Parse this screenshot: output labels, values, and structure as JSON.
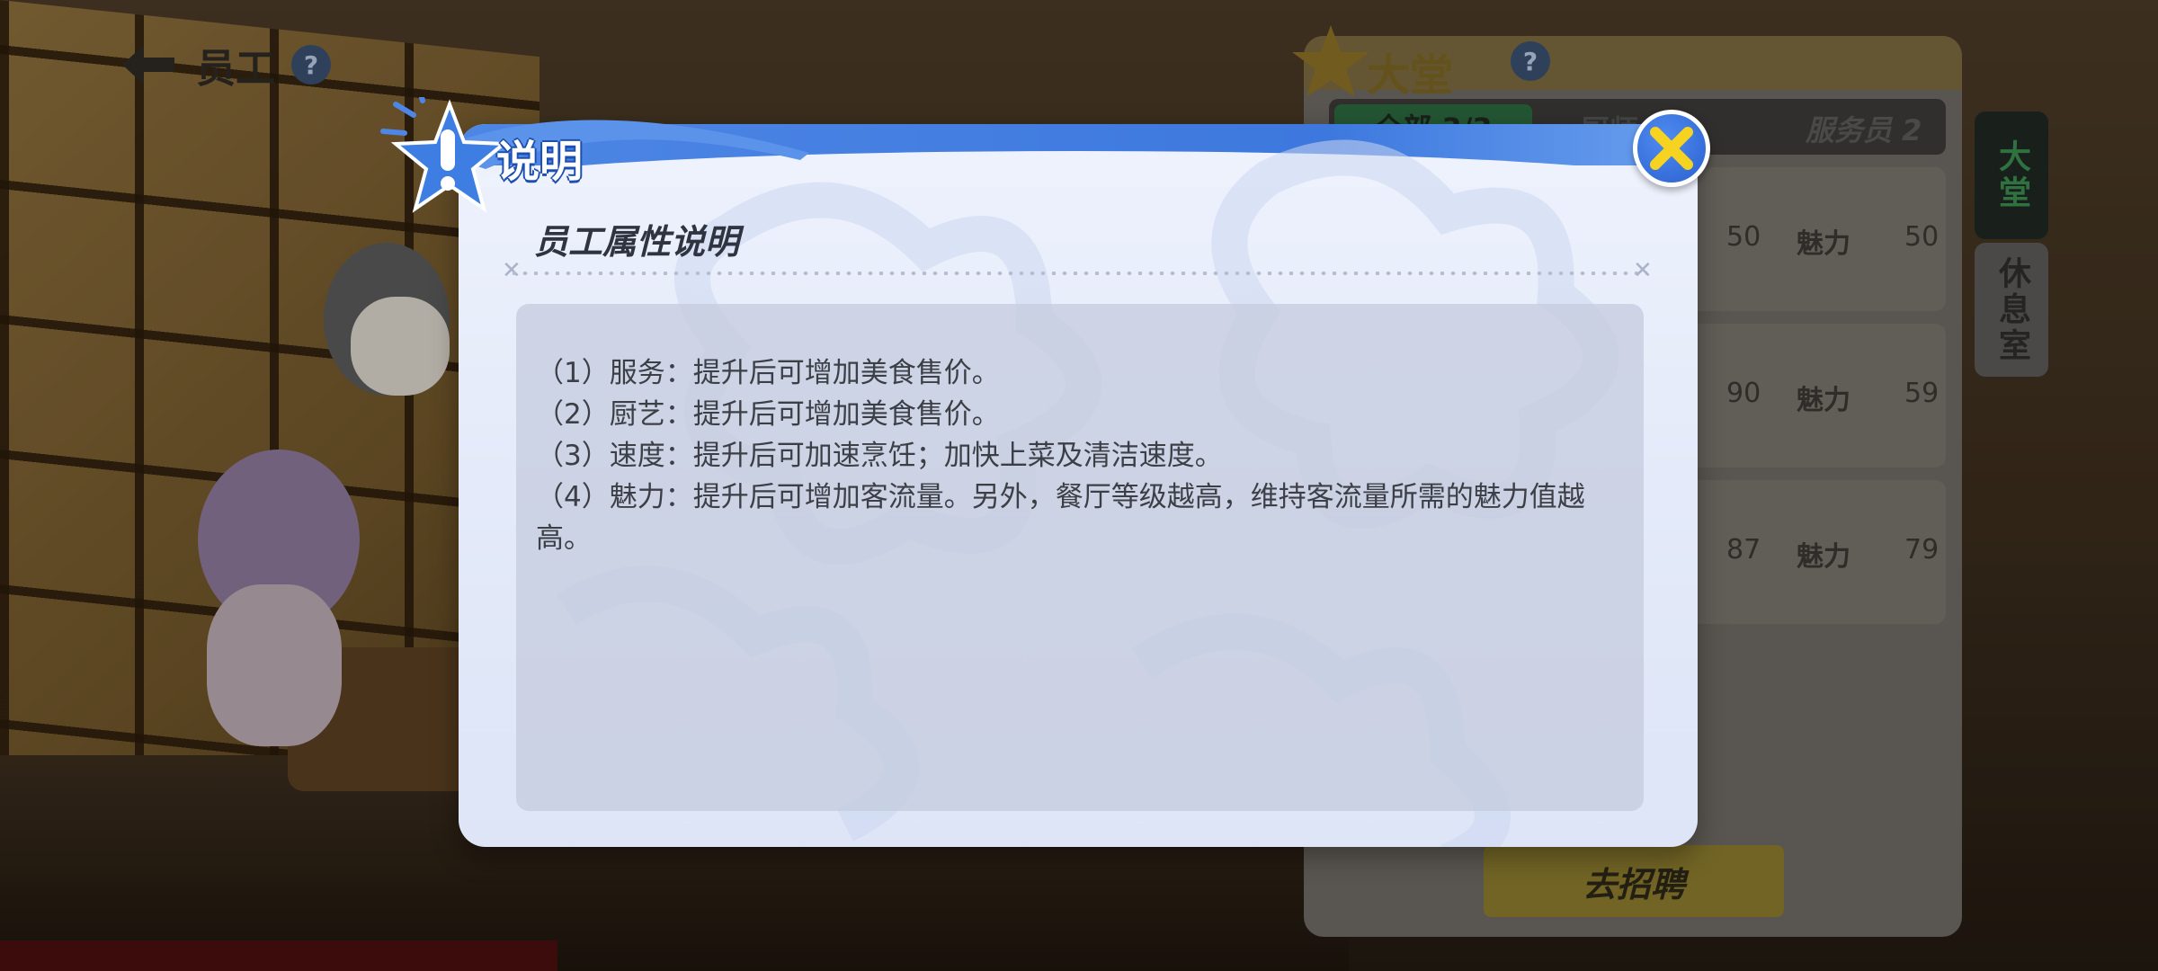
{
  "header": {
    "title": "员工",
    "help_label": "?"
  },
  "hall_panel": {
    "title": "大堂",
    "help_label": "?",
    "tabs": [
      {
        "label": "全部 3/3"
      },
      {
        "label": "厨师"
      },
      {
        "label": "服务员 2"
      }
    ],
    "rows": [
      {
        "value_a": "50",
        "attr_label": "魅力",
        "value_b": "50"
      },
      {
        "value_a": "90",
        "attr_label": "魅力",
        "value_b": "59"
      },
      {
        "value_a": "87",
        "attr_label": "魅力",
        "value_b": "79"
      }
    ],
    "recruit_label": "去招聘"
  },
  "side_tabs": {
    "hall": "大堂",
    "rest_room": "休息室"
  },
  "dialog": {
    "badge_label": "说明",
    "heading": "员工属性说明",
    "lines": [
      "（1）服务：提升后可增加美食售价。",
      "（2）厨艺：提升后可增加美食售价。",
      "（3）速度：提升后可加速烹饪；加快上菜及清洁速度。",
      "（4）魅力：提升后可增加客流量。另外，餐厅等级越高，维持客流量所需的魅力值越高。"
    ]
  },
  "colors": {
    "dialog_band": "#4d86e4",
    "close_button": "#2a61cf",
    "close_cross": "#f6d320",
    "active_side_tab_text": "#3a8a4e"
  }
}
